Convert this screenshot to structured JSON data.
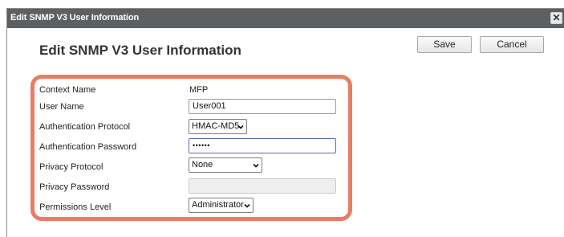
{
  "window": {
    "title": "Edit SNMP V3 User Information",
    "close_glyph": "✕"
  },
  "page": {
    "heading": "Edit SNMP V3 User Information"
  },
  "actions": {
    "save_label": "Save",
    "cancel_label": "Cancel"
  },
  "form": {
    "context_name": {
      "label": "Context Name",
      "value": "MFP"
    },
    "user_name": {
      "label": "User Name",
      "value": "User001"
    },
    "auth_protocol": {
      "label": "Authentication Protocol",
      "value": "HMAC-MD5"
    },
    "auth_password": {
      "label": "Authentication Password",
      "value": "••••••"
    },
    "privacy_protocol": {
      "label": "Privacy Protocol",
      "value": "None"
    },
    "privacy_password": {
      "label": "Privacy Password",
      "value": ""
    },
    "permissions_level": {
      "label": "Permissions Level",
      "value": "Administrator"
    }
  },
  "colors": {
    "titlebar": "#5d6063",
    "highlight": "#ea7c64"
  }
}
